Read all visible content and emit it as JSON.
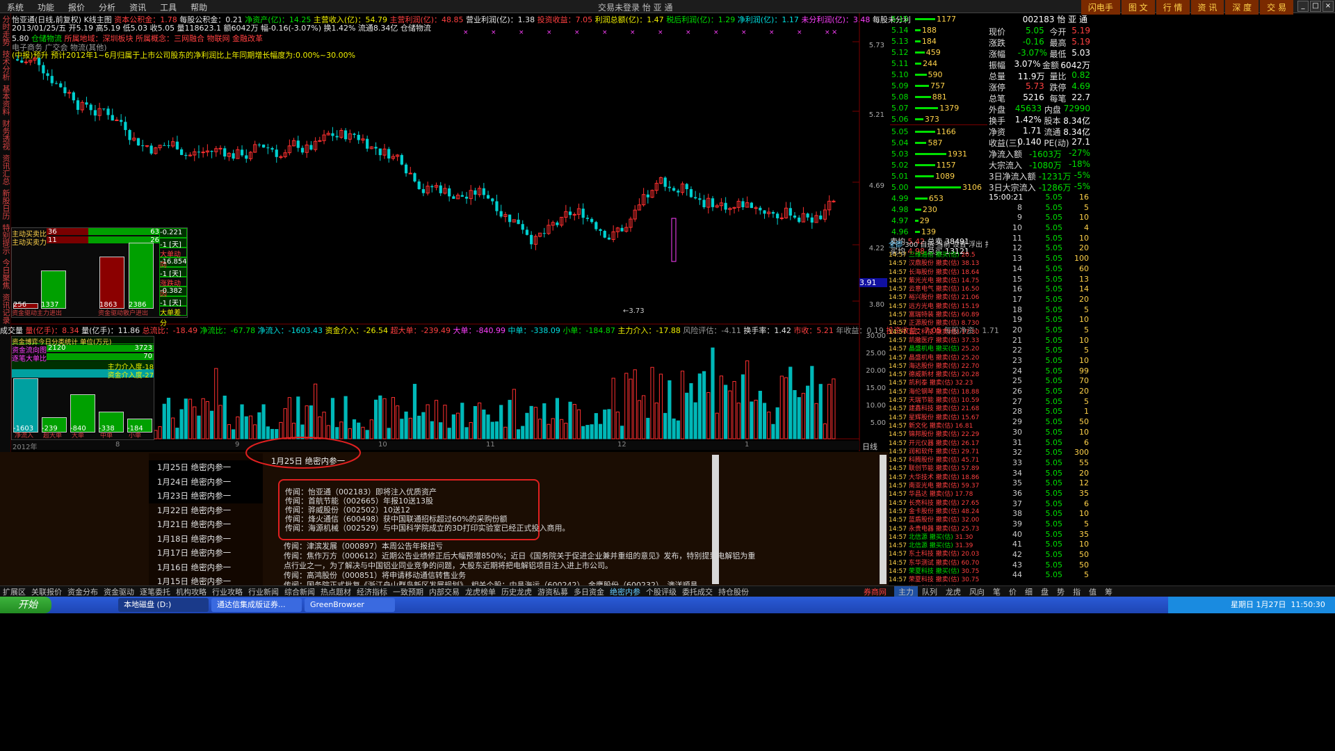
{
  "menu": {
    "items": [
      "系统",
      "功能",
      "报价",
      "分析",
      "资讯",
      "工具",
      "帮助"
    ],
    "center": "交易未登录   怡 亚 通",
    "right": [
      "闪电手",
      "图 文",
      "行 情",
      "资 讯",
      "深 度",
      "交 易"
    ]
  },
  "leftnav": [
    "分时走势",
    "技术分析",
    "基本资料",
    "财务透视",
    "资讯汇总",
    "新股日历",
    "特别提示",
    "今日聚焦",
    "资讯记录"
  ],
  "header": {
    "title": "怡亚通(日线,前复权) K线主图",
    "line1": [
      {
        "t": "资本公积金：1.78",
        "c": "red"
      },
      {
        "t": "每股公积金：0.21",
        "c": "wht"
      },
      {
        "t": "净资产(亿)：14.25",
        "c": "grn"
      },
      {
        "t": "主营收入(亿)：54.79",
        "c": "yel"
      },
      {
        "t": "主营利润(亿)：48.85",
        "c": "red"
      },
      {
        "t": "营业利润(亿)：1.38",
        "c": "wht"
      },
      {
        "t": "投资收益：7.05",
        "c": "red"
      },
      {
        "t": "利润总额(亿)：1.47",
        "c": "yel"
      },
      {
        "t": "税后利润(亿)：1.29",
        "c": "grn"
      },
      {
        "t": "净利润(亿)：1.17",
        "c": "cyan"
      },
      {
        "t": "未分利润(亿)：3.48",
        "c": "mag"
      },
      {
        "t": "每股未分利",
        "c": "wht"
      }
    ],
    "line2": "2013/01/25/五 开5.19 高5.19 低5.03 收5.05 量118623.1 额6042万 幅-0.16(-3.07%) 换1.42% 流通8.34亿 仓储物流",
    "line3": [
      {
        "t": "5.80",
        "c": "wht"
      },
      {
        "t": "仓储物流",
        "c": "grn"
      },
      {
        "t": "所属地域：深圳板块",
        "c": "red"
      },
      {
        "t": "所属概念：三网融合 物联网 金融改革",
        "c": "red"
      }
    ],
    "line4": "电子商务 广交会 物流(其他)",
    "line5": "(中报)预升 预计2012年1~6月归属于上市公司股东的净利润比上年同期增长幅度为:0.00%~30.00%",
    "price_labels": [
      "5.73",
      "5.21",
      "4.69",
      "4.22",
      "3.80"
    ],
    "low_mark": "←3.73",
    "cursor_price": "3.91"
  },
  "bs_panel": {
    "rows": [
      {
        "label": "主动买卖比",
        "a": "36",
        "b": "63"
      },
      {
        "label": "主动买卖力",
        "a": "11",
        "b": "26"
      }
    ],
    "bars": [
      {
        "v": "256"
      },
      {
        "v": "1337"
      },
      {
        "v": "1863"
      },
      {
        "v": "2386"
      }
    ],
    "foot": [
      "资金驱动主力进出",
      "资金驱动散户进出"
    ],
    "side": [
      {
        "t": "-0.221"
      },
      {
        "t": "-1 [天]"
      },
      {
        "t": "大单动向",
        "c": "red"
      },
      {
        "t": "-16.854"
      },
      {
        "t": "-1 [天]"
      },
      {
        "t": "涨跌动因",
        "c": "red"
      },
      {
        "t": "-0.382"
      },
      {
        "t": "-1 [天]"
      },
      {
        "t": "大单差分",
        "c": "yel"
      }
    ]
  },
  "vol_header": [
    {
      "t": "成交量",
      "c": "wht"
    },
    {
      "t": "量(亿手)：8.34",
      "c": "red"
    },
    {
      "t": "量(亿手)：11.86",
      "c": "wht"
    },
    {
      "t": "总流比：-18.49",
      "c": "red"
    },
    {
      "t": "净流比：-67.78",
      "c": "grn"
    },
    {
      "t": "净流入：-1603.43",
      "c": "cyan"
    },
    {
      "t": "资金介入：-26.54",
      "c": "yel"
    },
    {
      "t": "超大单：-239.49",
      "c": "red"
    },
    {
      "t": "大单：-840.99",
      "c": "mag"
    },
    {
      "t": "中单：-338.09",
      "c": "cyan"
    },
    {
      "t": "小单：-184.87",
      "c": "grn"
    },
    {
      "t": "主力介入：-17.88",
      "c": "yel"
    },
    {
      "t": "风险评估：-4.11",
      "c": "gry"
    },
    {
      "t": "换手率：1.42",
      "c": "wht"
    },
    {
      "t": "市收：5.21",
      "c": "red"
    },
    {
      "t": "年收益：0.19",
      "c": "gry"
    },
    {
      "t": "投资收益：7.05",
      "c": "red"
    },
    {
      "t": "每股净资：1.71",
      "c": "gry"
    }
  ],
  "vol_labels": [
    "30.00",
    "25.00",
    "20.00",
    "15.00",
    "10.00",
    "5.00"
  ],
  "flow_panel": {
    "head": [
      "资金博弈今日分类统计",
      "单位(万元)"
    ],
    "rows": [
      {
        "l": "资金流向图",
        "v": "2120",
        "v2": "3723"
      },
      {
        "l": "逐笔大单比",
        "v": "",
        "v2": "70"
      }
    ],
    "l1": "主力介入度-18",
    "l2": "资金介入度-27",
    "bars": [
      {
        "v": "-1603",
        "l": "净流入"
      },
      {
        "v": "-239",
        "l": "超大单"
      },
      {
        "v": "-840",
        "l": "大单"
      },
      {
        "v": "-338",
        "l": "中单"
      },
      {
        "v": "-184",
        "l": "小单"
      }
    ]
  },
  "timeline": {
    "labels": [
      "2012年",
      "8",
      "9",
      "10",
      "11",
      "12",
      "1"
    ],
    "mode": "日线"
  },
  "news": {
    "title": "1月25日  绝密内参一",
    "dates": [
      "1月25日  绝密内参一",
      "1月24日  绝密内参一",
      "1月23日  绝密内参一",
      "1月22日  绝密内参一",
      "1月21日  绝密内参一",
      "1月18日  绝密内参一",
      "1月17日  绝密内参一",
      "1月16日  绝密内参一",
      "1月15日  绝密内参一"
    ],
    "boxed": [
      "传闻：怡亚通（002183）即将注入优质资产",
      "传闻：首航节能（002665）年报10送13股",
      "传闻：骅威股份（002502）10送12",
      "传闻：烽火通信（600498）获中国联通招标超过60%的采购份额",
      "传闻：海源机械（002529）与中国科学院成立的3D打印实验室已经正式投入商用。"
    ],
    "more": [
      "传闻：津滨发展（000897）本周公告年报扭亏",
      "传闻：焦作万方（000612）近期公告业绩修正后大幅预增850%；近日《国务院关于促进企业兼并重组的意见》发布，特别提到电解铝为重",
      "点行业之一，为了解决与中国铝业同业竞争的问题，大股东近期将把电解铝项目注入进上市公司。",
      "传闻：高鸿股份（000851）将申请移动通信转售业务",
      "传闻：国务院正式批复《浙江舟山群岛新区发展规划》，相关个股：中昌海运（600242）、金鹰股份（600232）、澳洋顺昌"
    ]
  },
  "orderbook": {
    "sells": [
      {
        "p": "5.15",
        "v": "1177"
      },
      {
        "p": "5.14",
        "v": "188"
      },
      {
        "p": "5.13",
        "v": "184"
      },
      {
        "p": "5.12",
        "v": "459"
      },
      {
        "p": "5.11",
        "v": "244"
      },
      {
        "p": "5.10",
        "v": "590"
      },
      {
        "p": "5.09",
        "v": "757"
      },
      {
        "p": "5.08",
        "v": "881"
      },
      {
        "p": "5.07",
        "v": "1379"
      },
      {
        "p": "5.06",
        "v": "373"
      }
    ],
    "buys": [
      {
        "p": "5.05",
        "v": "1166"
      },
      {
        "p": "5.04",
        "v": "587"
      },
      {
        "p": "5.03",
        "v": "1931"
      },
      {
        "p": "5.02",
        "v": "1157"
      },
      {
        "p": "5.01",
        "v": "1089"
      },
      {
        "p": "5.00",
        "v": "3106"
      },
      {
        "p": "4.99",
        "v": "653"
      },
      {
        "p": "4.98",
        "v": "230"
      },
      {
        "p": "4.97",
        "v": "29"
      },
      {
        "p": "4.96",
        "v": "139"
      }
    ],
    "avg_sell": "5.42",
    "total_sell": "38491",
    "avg_buy": "4.98",
    "total_buy": "13121",
    "sell_label": "卖均",
    "buy_label": "买均",
    "ts_label": "总卖",
    "tb_label": "总买",
    "tabs": [
      "全部",
      "300",
      "自选",
      "当前",
      "设置",
      "浮出",
      "扌"
    ]
  },
  "trades": {
    "time": "14:57",
    "names": [
      "三维通信",
      "汉鼎股份",
      "长海股份",
      "紫光光电",
      "云意电气",
      "裕兴股份",
      "远方光电",
      "富瑞特装",
      "正源股份",
      "吉艾科技",
      "凯撒医疗",
      "晶盛机电",
      "晶盛机电",
      "海达股份",
      "德威新材",
      "凯利泰",
      "海伦钢琴",
      "天瑞节能",
      "建鑫科技",
      "星辉股份",
      "新文化",
      "锦邦股份",
      "开元仪器",
      "润和软件",
      "科腾股份",
      "联创节能",
      "大华技术",
      "南亚光电",
      "华昌达",
      "长亮科技",
      "金卡股份",
      "蓝盾股份",
      "永贵电器",
      "北信源",
      "北信源",
      "东土科技",
      "东华测试",
      "荣夏科技",
      "荣夏科技",
      "光一科技"
    ],
    "actions": [
      "撤买(估)",
      "撤卖(估)",
      "撤卖(估)",
      "撤卖(估)",
      "撤卖(估)",
      "撤卖(估)",
      "撤卖(估)",
      "撤卖(估)",
      "撤卖(估)",
      "撤卖(估)",
      "撤卖(估)",
      "撤买(估)",
      "撤卖(估)",
      "撤卖(估)",
      "撤卖(估)",
      "撤卖(估)",
      "撤卖(估)",
      "撤卖(估)",
      "撤卖(估)",
      "撤卖(估)",
      "撤卖(估)",
      "撤卖(估)",
      "撤卖(估)",
      "撤卖(估)",
      "撤卖(估)",
      "撤卖(估)",
      "撤卖(估)",
      "撤卖(估)",
      "撤卖(估)",
      "撤卖(估)",
      "撤卖(估)",
      "撤卖(估)",
      "撤卖(估)",
      "撤买(估)",
      "撤买(估)",
      "撤卖(估)",
      "撤卖(估)",
      "撤买(估)",
      "撤卖(估)",
      "撤卖(估)"
    ],
    "prices": [
      "20.5",
      "38.13",
      "18.64",
      "14.75",
      "16.50",
      "21.06",
      "15.19",
      "60.89",
      "8.730",
      "17.30",
      "37.33",
      "25.20",
      "25.20",
      "22.70",
      "20.28",
      "32.23",
      "18.88",
      "10.59",
      "21.68",
      "15.67",
      "16.81",
      "22.29",
      "26.17",
      "29.71",
      "45.71",
      "57.89",
      "18.86",
      "59.37",
      "17.78",
      "27.65",
      "48.24",
      "32.00",
      "25.73",
      "31.30",
      "31.39",
      "20.03",
      "60.70",
      "30.75",
      "30.75",
      "22.90"
    ]
  },
  "quote": {
    "code": "002183",
    "name": "怡 亚 通",
    "rows": [
      [
        "现价",
        "5.05",
        "今开",
        "5.19"
      ],
      [
        "涨跌",
        "-0.16",
        "最高",
        "5.19"
      ],
      [
        "涨幅",
        "-3.07%",
        "最低",
        "5.03"
      ],
      [
        "振幅",
        "3.07%",
        "金额",
        "6042万"
      ],
      [
        "总量",
        "11.9万",
        "量比",
        "0.82"
      ],
      [
        "涨停",
        "5.73",
        "跌停",
        "4.69"
      ],
      [
        "总笔",
        "5216",
        "每笔",
        "22.7"
      ],
      [
        "外盘",
        "45633",
        "内盘",
        "72990"
      ],
      [
        "换手",
        "1.42%",
        "股本",
        "8.34亿"
      ],
      [
        "净资",
        "1.71",
        "流通",
        "8.34亿"
      ],
      [
        "收益(三)",
        "0.140",
        "PE(动)",
        "27.1"
      ]
    ],
    "flow": [
      [
        "净流入额",
        "-1603万",
        "-27%"
      ],
      [
        "大宗流入",
        "-1080万",
        "-18%"
      ],
      [
        "3日净流入额",
        "-1231万",
        "-5%"
      ],
      [
        "3日大宗流入",
        "-1286万",
        "-5%"
      ]
    ],
    "ticks": [
      [
        "15:00:21",
        "5.05",
        "16"
      ],
      [
        "8",
        "5.05",
        "5"
      ],
      [
        "9",
        "5.05",
        "10"
      ],
      [
        "10",
        "5.05",
        "4"
      ],
      [
        "11",
        "5.05",
        "10"
      ],
      [
        "12",
        "5.05",
        "20"
      ],
      [
        "13",
        "5.05",
        "100"
      ],
      [
        "14",
        "5.05",
        "60"
      ],
      [
        "15",
        "5.05",
        "13"
      ],
      [
        "16",
        "5.05",
        "14"
      ],
      [
        "17",
        "5.05",
        "20"
      ],
      [
        "18",
        "5.05",
        "5"
      ],
      [
        "19",
        "5.05",
        "10"
      ],
      [
        "20",
        "5.05",
        "5"
      ],
      [
        "21",
        "5.05",
        "10"
      ],
      [
        "22",
        "5.05",
        "5"
      ],
      [
        "23",
        "5.05",
        "10"
      ],
      [
        "24",
        "5.05",
        "99"
      ],
      [
        "25",
        "5.05",
        "70"
      ],
      [
        "26",
        "5.05",
        "20"
      ],
      [
        "27",
        "5.05",
        "5"
      ],
      [
        "28",
        "5.05",
        "1"
      ],
      [
        "29",
        "5.05",
        "50"
      ],
      [
        "30",
        "5.05",
        "10"
      ],
      [
        "31",
        "5.05",
        "6"
      ],
      [
        "32",
        "5.05",
        "300"
      ],
      [
        "33",
        "5.05",
        "55"
      ],
      [
        "34",
        "5.05",
        "20"
      ],
      [
        "35",
        "5.05",
        "12"
      ],
      [
        "36",
        "5.05",
        "35"
      ],
      [
        "37",
        "5.05",
        "6"
      ],
      [
        "38",
        "5.05",
        "10"
      ],
      [
        "39",
        "5.05",
        "5"
      ],
      [
        "40",
        "5.05",
        "35"
      ],
      [
        "41",
        "5.05",
        "10"
      ],
      [
        "42",
        "5.05",
        "50"
      ],
      [
        "43",
        "5.05",
        "50"
      ],
      [
        "44",
        "5.05",
        "5"
      ]
    ]
  },
  "bottom": {
    "tabs": [
      "扩展区",
      "关联报价",
      "资金分布",
      "资金驱动",
      "逐笔委托",
      "机构攻略",
      "行业攻略",
      "行业新闻",
      "综合新闻",
      "热点题材",
      "经济指标",
      "一致预期",
      "内部交易",
      "龙虎榜单",
      "历史龙虎",
      "游资私募",
      "多日资金",
      "绝密内参",
      "个股评级",
      "委托成交",
      "持仓股份"
    ],
    "right": [
      "主力",
      "队列",
      "龙虎",
      "风向",
      "笔",
      "价",
      "细",
      "盘",
      "势",
      "指",
      "值",
      "筹"
    ],
    "active": "绝密内参",
    "newsbtn": "券商网"
  },
  "taskbar": {
    "start": "开始",
    "items": [
      "本地磁盘 (D:)",
      "通达信集成版证券...",
      "GreenBrowser"
    ],
    "date": "星期日 1月27日",
    "time": "11:50:30"
  }
}
